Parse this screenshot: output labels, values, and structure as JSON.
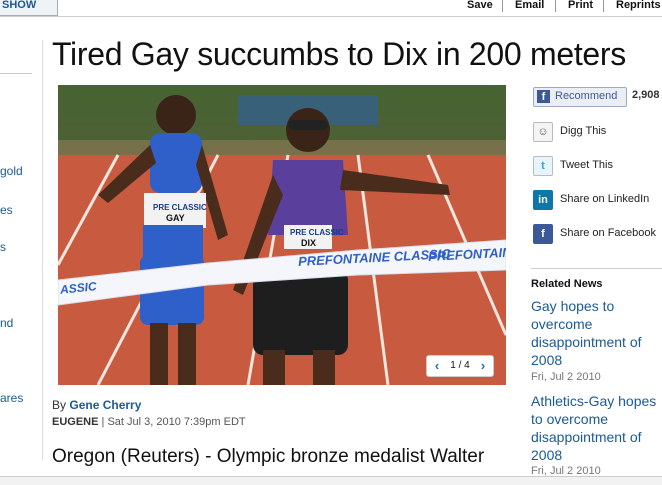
{
  "topbar": {
    "show_tab": "SHOW",
    "tools": [
      "Save",
      "Email",
      "Print",
      "Reprints"
    ]
  },
  "left_fragments": [
    "gold",
    "es",
    "s",
    "nd",
    "ares"
  ],
  "article": {
    "headline": "Tired Gay succumbs to Dix in 200 meters",
    "byline_prefix": "By",
    "author": "Gene Cherry",
    "location": "EUGENE",
    "date": "| Sat Jul 3, 2010 7:39pm EDT",
    "lead": "Oregon (Reuters) - Olympic bronze medalist Walter"
  },
  "photo": {
    "pager": "1 / 4",
    "prev": "‹",
    "next": "›",
    "tape_text": "PREFONTAINE CLASSIC",
    "tape_text_left": "ASSIC",
    "bib_gay": "GAY",
    "bib_dix": "DIX",
    "bib_top": "PRE CLASSIC"
  },
  "share": {
    "recommend": "Recommend",
    "recommend_count": "2,908",
    "items": [
      {
        "label": "Digg This",
        "icon": "digg-icon"
      },
      {
        "label": "Tweet This",
        "icon": "twitter-icon"
      },
      {
        "label": "Share on LinkedIn",
        "icon": "linkedin-icon"
      },
      {
        "label": "Share on Facebook",
        "icon": "facebook-icon"
      }
    ]
  },
  "related": {
    "heading": "Related News",
    "items": [
      {
        "lines": [
          "Gay hopes to",
          "overcome",
          "disappointment of",
          "2008"
        ],
        "date": "Fri, Jul 2 2010"
      },
      {
        "lines": [
          "Athletics-Gay hopes",
          "to overcome",
          "disappointment of",
          "2008"
        ],
        "date": "Fri, Jul 2 2010"
      }
    ]
  },
  "colors": {
    "link": "#1a5a96",
    "facebook": "#3b5998",
    "track": "#c4553c"
  }
}
